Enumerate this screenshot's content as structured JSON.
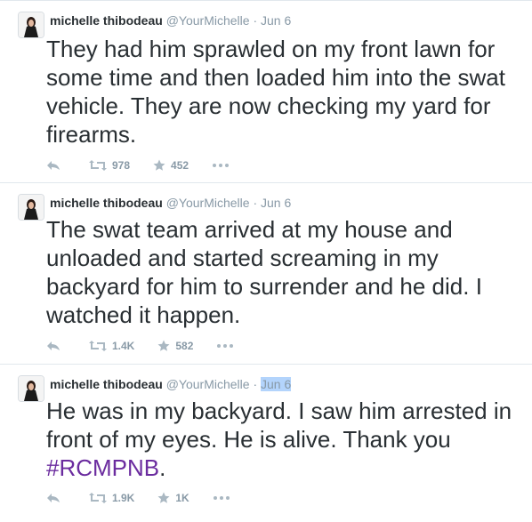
{
  "tweets": [
    {
      "name": "michelle thibodeau",
      "handle": "@YourMichelle",
      "separator": "·",
      "time": "Jun 6",
      "text": "They had him sprawled on my front lawn for some time and then loaded him into the swat vehicle. They are now checking my yard for firearms.",
      "retweets": "978",
      "favorites": "452"
    },
    {
      "name": "michelle thibodeau",
      "handle": "@YourMichelle",
      "separator": "·",
      "time": "Jun 6",
      "text": "The swat team arrived at my house and unloaded and started screaming in my backyard for him to surrender and he did. I watched it happen.",
      "retweets": "1.4K",
      "favorites": "582"
    },
    {
      "name": "michelle thibodeau",
      "handle": "@YourMichelle",
      "separator": "·",
      "time": "Jun 6",
      "text": "He was in my backyard. I saw him arrested in front of my eyes. He is alive. Thank you ",
      "hashtag": "#RCMPNB",
      "text_end": ".",
      "retweets": "1.9K",
      "favorites": "1K"
    }
  ],
  "icons": {
    "reply": "reply-icon",
    "retweet": "retweet-icon",
    "favorite": "star-icon",
    "more": "more-icon"
  },
  "colors": {
    "name": "#292f33",
    "meta": "#8899a6",
    "hashtag": "#6b2c9f",
    "highlight": "#b3d4fc",
    "border": "#e1e8ed"
  }
}
